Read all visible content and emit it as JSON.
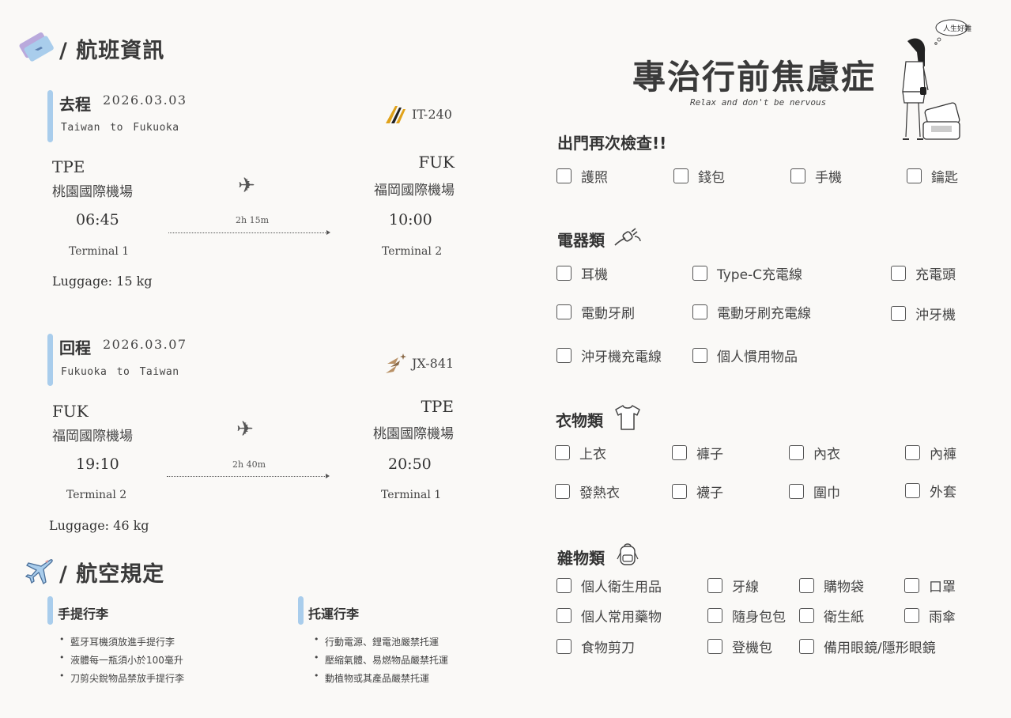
{
  "flight_section": {
    "title": "/ 航班資訊",
    "icon": "ticket-icon"
  },
  "outbound": {
    "title": "去程",
    "date": "2026.03.03",
    "route": "Taiwan to Fukuoka",
    "flight_no": "IT-240",
    "airline_icon": "tiger-logo",
    "origin_code": "TPE",
    "origin_airport": "桃園國際機場",
    "dest_code": "FUK",
    "dest_airport": "福岡國際機場",
    "depart_time": "06:45",
    "arrive_time": "10:00",
    "duration": "2h 15m",
    "depart_terminal": "Terminal 1",
    "arrive_terminal": "Terminal 2",
    "luggage": "Luggage: 15 kg"
  },
  "return": {
    "title": "回程",
    "date": "2026.03.07",
    "route": "Fukuoka to Taiwan",
    "flight_no": "JX-841",
    "airline_icon": "starlux-logo",
    "origin_code": "FUK",
    "origin_airport": "福岡國際機場",
    "dest_code": "TPE",
    "dest_airport": "桃園國際機場",
    "depart_time": "19:10",
    "arrive_time": "20:50",
    "duration": "2h 40m",
    "depart_terminal": "Terminal 2",
    "arrive_terminal": "Terminal 1",
    "luggage": "Luggage: 46 kg"
  },
  "rules_section": {
    "title": "/ 航空規定",
    "icon": "airplane-icon"
  },
  "carry_on": {
    "title": "手提行李",
    "items": [
      "藍牙耳機須放進手提行李",
      "液體每一瓶須小於100毫升",
      "刀剪尖銳物品禁放手提行李"
    ]
  },
  "checked": {
    "title": "托運行李",
    "items": [
      "行動電源、鋰電池嚴禁托運",
      "壓縮氣體、易燃物品嚴禁托運",
      "動植物或其產品嚴禁托運"
    ]
  },
  "header": {
    "title": "專治行前焦慮症",
    "subtitle": "Relax and don't be nervous",
    "bubble_text": "人生好難"
  },
  "checklist": {
    "before_leaving": {
      "title": "出門再次檢查!!",
      "items": [
        "護照",
        "錢包",
        "手機",
        "鑰匙"
      ]
    },
    "electronics": {
      "title": "電器類",
      "icon": "plug-icon",
      "items": [
        "耳機",
        "Type-C充電線",
        "充電頭",
        "電動牙刷",
        "電動牙刷充電線",
        "沖牙機",
        "沖牙機充電線",
        "個人慣用物品"
      ]
    },
    "clothing": {
      "title": "衣物類",
      "icon": "tshirt-icon",
      "items": [
        "上衣",
        "褲子",
        "內衣",
        "內褲",
        "發熱衣",
        "襪子",
        "圍巾",
        "外套"
      ]
    },
    "misc": {
      "title": "雜物類",
      "icon": "backpack-icon",
      "items": [
        "個人衛生用品",
        "牙線",
        "購物袋",
        "口罩",
        "個人常用藥物",
        "隨身包包",
        "衛生紙",
        "雨傘",
        "食物剪刀",
        "登機包",
        "備用眼鏡/隱形眼鏡"
      ]
    }
  }
}
